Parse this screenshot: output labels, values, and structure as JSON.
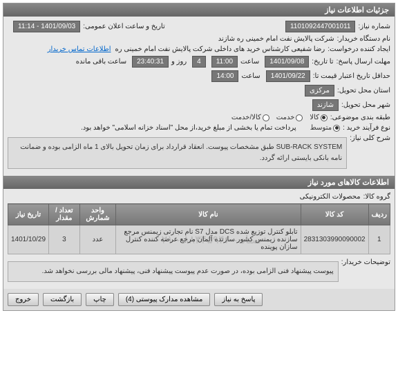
{
  "header1": "جزئیات اطلاعات نیاز",
  "needNo": {
    "label": "شماره نیاز:",
    "value": "1101092447001011"
  },
  "announce": {
    "label": "تاریخ و ساعت اعلان عمومی:",
    "value": "1401/09/03 - 11:14"
  },
  "buyerName": {
    "label": "نام دستگاه خریدار:",
    "value": "شرکت پالایش نفت امام خمینی ره شازند"
  },
  "requester": {
    "label": "ایجاد کننده درخواست:",
    "value": "رضا شفیعی کارشناس خرید های داخلی شرکت پالایش نفت امام خمینی ره"
  },
  "contactLink": "اطلاعات تماس خریدار",
  "deadlineSend": {
    "label": "مهلت ارسال پاسخ:",
    "taLabel": "تا تاریخ:",
    "date": "1401/09/08",
    "timeLabel": "ساعت",
    "time": "11:00",
    "remainLabel": "روز و",
    "remainDays": "4",
    "remain": "23:40:31",
    "remainSuffix": "ساعت باقی مانده"
  },
  "validity": {
    "label": "حداقل تاریخ اعتبار قیمت تا:",
    "date": "1401/09/22",
    "timeLabel": "ساعت",
    "time": "14:00"
  },
  "locProvince": {
    "label": "استان محل تحویل:",
    "value": "مرکزی"
  },
  "locCity": {
    "label": "شهر محل تحویل:",
    "value": "شازند"
  },
  "category": {
    "label": "طبقه بندی موضوعی:",
    "options": [
      {
        "label": "کالا",
        "checked": true
      },
      {
        "label": "خدمت",
        "checked": false
      },
      {
        "label": "کالا/خدمت",
        "checked": false
      }
    ]
  },
  "buyProcess": {
    "label": "نوع فرآیند خرید :",
    "options": [
      {
        "label": "متوسط",
        "checked": true
      }
    ],
    "note": "پرداخت تمام یا بخشی از مبلغ خرید،از محل \"اسناد خزانه اسلامی\" خواهد بود."
  },
  "mainDesc": {
    "label": "شرح کلی نیاز:",
    "text": "SUB-RACK SYSTEM طبق مشخصات پیوست.\nانعقاد قرارداد برای زمان تحویل بالای 1 ماه الزامی بوده و ضمانت نامه بانکی بایستی ارائه گردد."
  },
  "header2": "اطلاعات کالاهای مورد نیاز",
  "group": {
    "label": "گروه کالا:",
    "value": "محصولات الکترونیکی"
  },
  "table": {
    "headers": [
      "ردیف",
      "کد کالا",
      "نام کالا",
      "واحد شمارش",
      "تعداد / مقدار",
      "تاریخ نیاز"
    ],
    "rows": [
      {
        "idx": "1",
        "code": "2831303990090002",
        "name": "تابلو کنترل توزیع شده DCS مدل S7 نام تجارتی زیمنس مرجع سازنده زیمنس کشور سازنده آلمان مرجع عرضه کننده کنترل سازان پوینده",
        "unit": "عدد",
        "qty": "3",
        "date": "1401/10/29"
      }
    ]
  },
  "watermark": "ستاد - ۸۸۳۴۵۹۴۶ - ۰۲۱",
  "explain": {
    "label": "توضیحات خریدار:",
    "text": "پیوست پیشنهاد فنی الزامی بوده، در صورت عدم پیوست پیشنهاد فنی، پیشنهاد مالی بررسی نخواهد شد."
  },
  "buttons": {
    "respond": "پاسخ به نیاز",
    "attachments": "مشاهده مدارک پیوستی (4)",
    "print": "چاپ",
    "back": "بازگشت",
    "exit": "خروج"
  }
}
